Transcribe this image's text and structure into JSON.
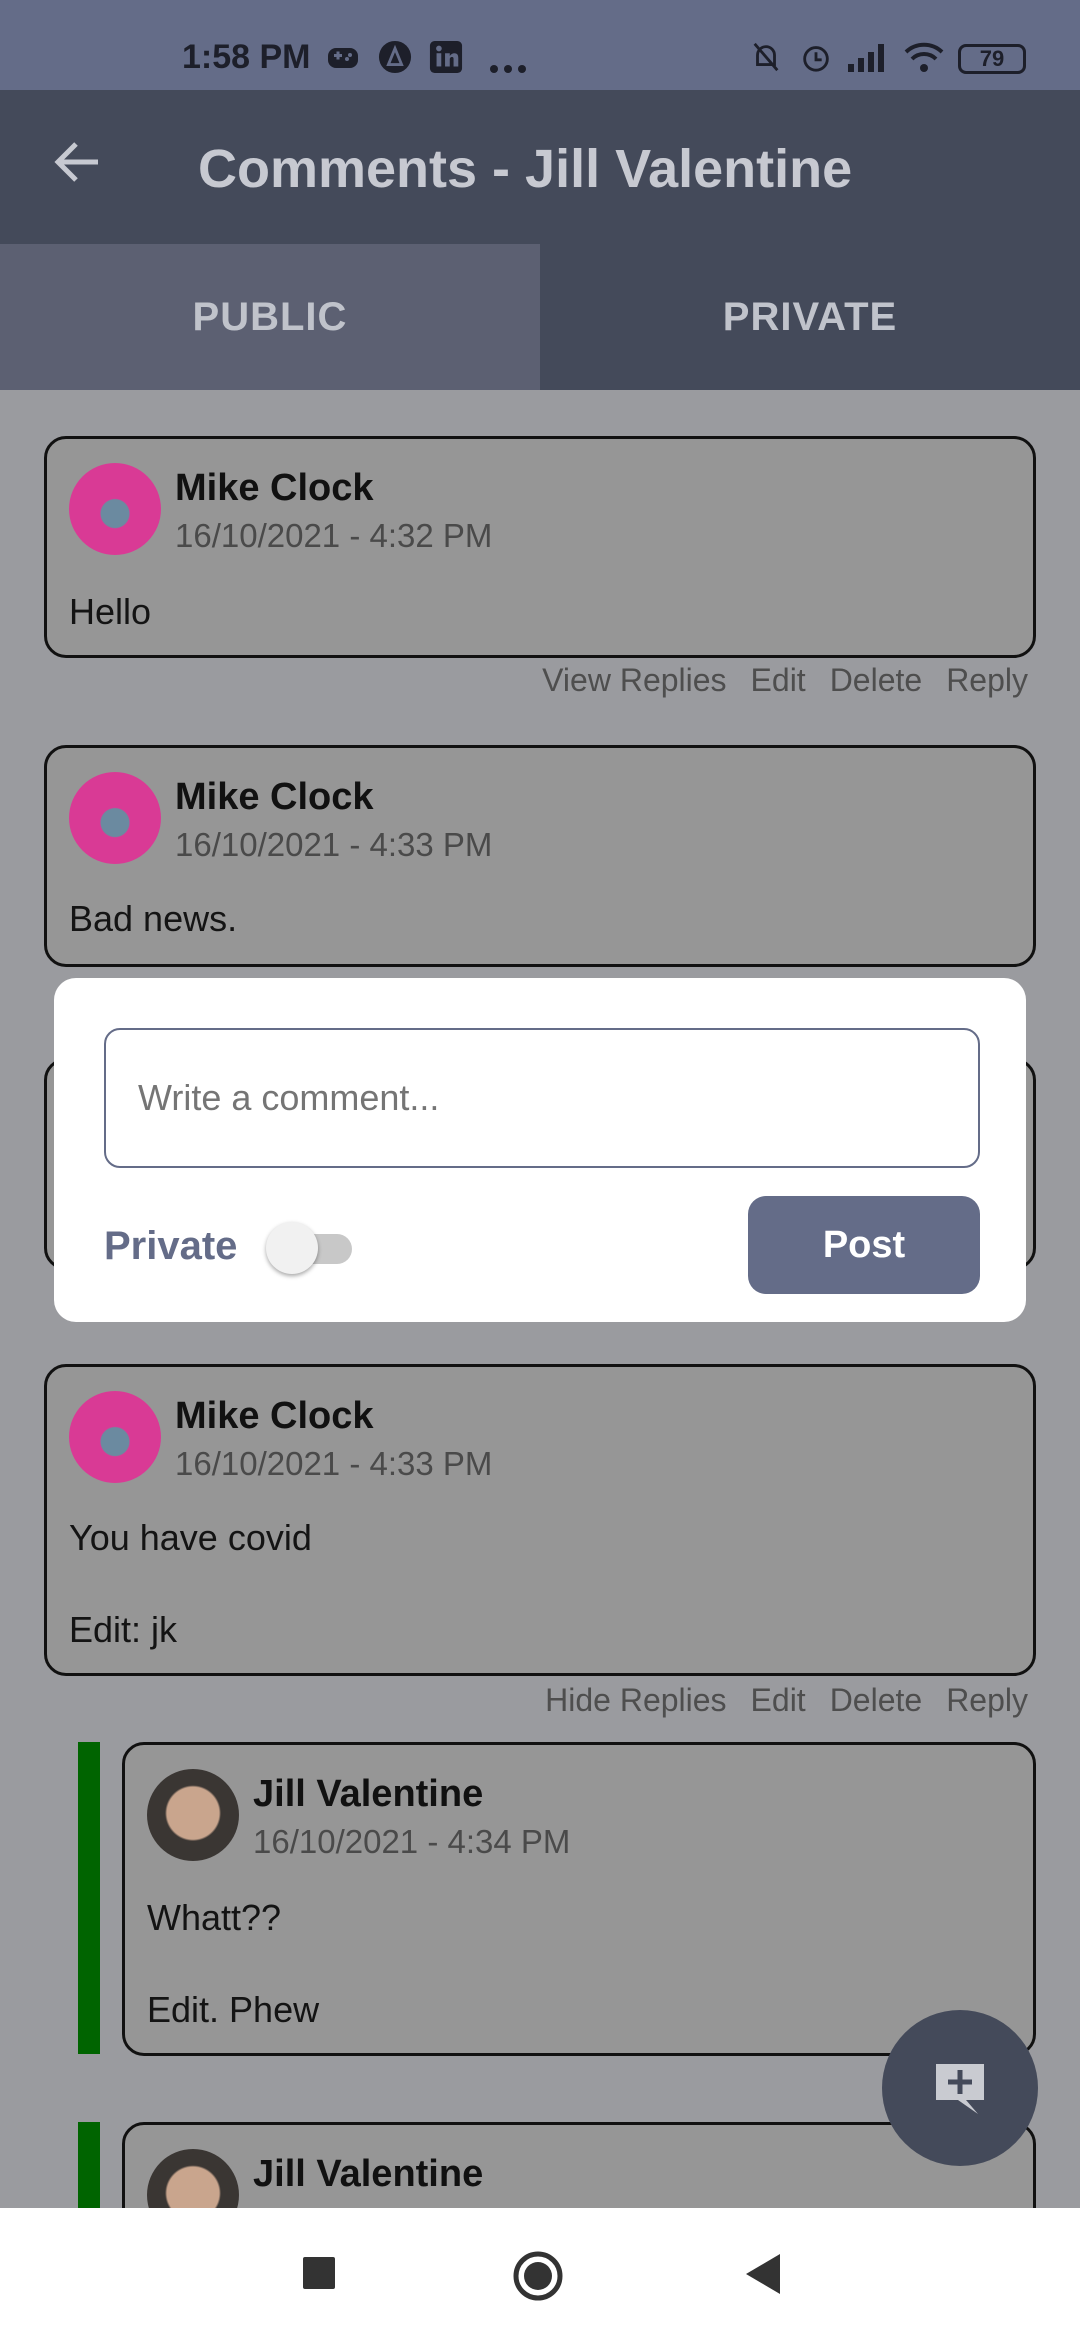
{
  "status_bar": {
    "time": "1:58 PM",
    "battery": "79",
    "left_icons": [
      "gamepad-icon",
      "a-circle-icon",
      "linkedin-icon",
      "more-icon"
    ],
    "right_icons": [
      "bell-off-icon",
      "alarm-icon",
      "signal-icon",
      "wifi-icon",
      "battery-icon"
    ]
  },
  "app_bar": {
    "title": "Comments - Jill Valentine",
    "back_icon": "arrow-back-icon"
  },
  "tabs": [
    {
      "label": "PUBLIC",
      "selected": true
    },
    {
      "label": "PRIVATE",
      "selected": false
    }
  ],
  "comments": [
    {
      "author": "Mike Clock",
      "timestamp": "16/10/2021 - 4:32 PM",
      "body": "Hello",
      "actions": [
        "View Replies",
        "Edit",
        "Delete",
        "Reply"
      ]
    },
    {
      "author": "Mike Clock",
      "timestamp": "16/10/2021 - 4:33 PM",
      "body": "Bad news."
    },
    {
      "author": "Mike Clock",
      "timestamp": "16/10/2021 - 4:33 PM",
      "body_lines": [
        "You have covid",
        "Edit: jk"
      ],
      "actions": [
        "Hide Replies",
        "Edit",
        "Delete",
        "Reply"
      ]
    }
  ],
  "replies": [
    {
      "author": "Jill Valentine",
      "timestamp": "16/10/2021 - 4:34 PM",
      "body_lines": [
        "Whatt??",
        "Edit. Phew"
      ]
    },
    {
      "author": "Jill Valentine"
    }
  ],
  "dialog": {
    "input_placeholder": "Write a comment...",
    "private_label": "Private",
    "private_enabled": false,
    "post_label": "Post"
  },
  "fab": {
    "icon": "add-comment-icon"
  },
  "nav_bar": {
    "icons": [
      "recents-square-icon",
      "home-circle-icon",
      "back-triangle-icon"
    ]
  }
}
